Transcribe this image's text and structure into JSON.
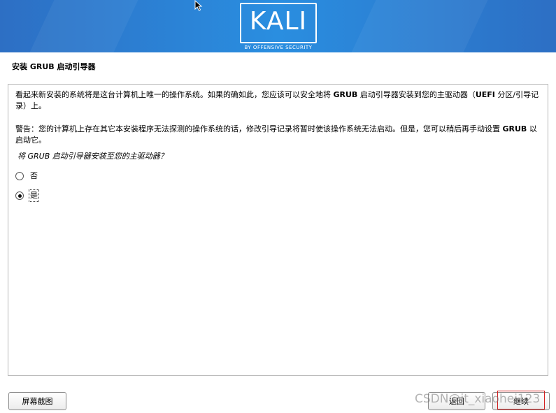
{
  "banner": {
    "logo_text": "KALI",
    "logo_subtitle": "BY OFFENSIVE SECURITY",
    "colors": {
      "banner_start": "#2d6fc4",
      "banner_mid": "#2a8ee0"
    }
  },
  "page": {
    "title": "安装 GRUB 启动引导器"
  },
  "content": {
    "para1_part1": "看起来新安装的系统将是这台计算机上唯一的操作系统。如果的确如此，您应该可以安全地将 ",
    "para1_bold1": "GRUB",
    "para1_part2": " 启动引导器安装到您的主驱动器（",
    "para1_bold2": "UEFI",
    "para1_part3": " 分区/引导记录）上。",
    "para2_part1": "警告：您的计算机上存在其它本安装程序无法探测的操作系统的话，修改引导记录将暂时使该操作系统无法启动。但是，您可以稍后再手动设置 ",
    "para2_bold1": "GRUB",
    "para2_part2": " 以启动它。",
    "question": "将 GRUB 启动引导器安装至您的主驱动器？",
    "options": [
      {
        "label": "否",
        "selected": false
      },
      {
        "label": "是",
        "selected": true
      }
    ]
  },
  "buttons": {
    "screenshot": "屏幕截图",
    "back": "返回",
    "continue": "继续"
  },
  "watermark": "CSDN@it_xiaohei123"
}
